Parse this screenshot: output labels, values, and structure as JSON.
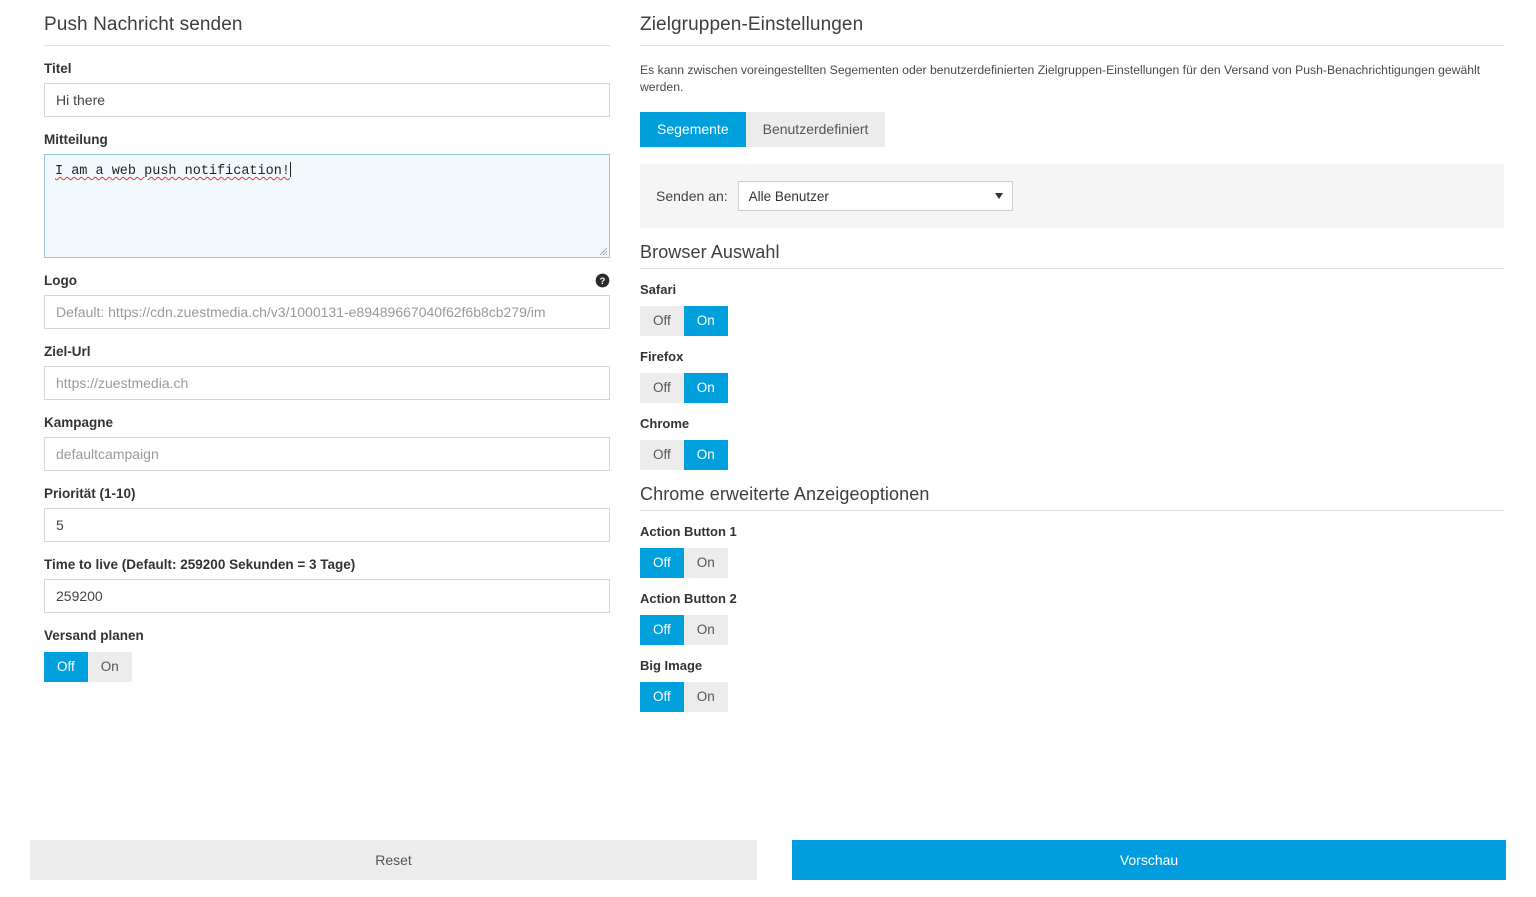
{
  "left": {
    "title": "Push Nachricht senden",
    "fields": {
      "titel": {
        "label": "Titel",
        "value": "Hi there"
      },
      "mitteilung": {
        "label": "Mitteilung",
        "value": "I am a web push notification!"
      },
      "logo": {
        "label": "Logo",
        "placeholder": "Default: https://cdn.zuestmedia.ch/v3/1000131-e89489667040f62f6b8cb279/im",
        "help_icon": "question-mark-circle-icon"
      },
      "ziel_url": {
        "label": "Ziel-Url",
        "placeholder": "https://zuestmedia.ch"
      },
      "kampagne": {
        "label": "Kampagne",
        "placeholder": "defaultcampaign"
      },
      "prioritaet": {
        "label": "Priorität (1-10)",
        "value": "5"
      },
      "ttl": {
        "label": "Time to live (Default: 259200 Sekunden = 3 Tage)",
        "value": "259200"
      },
      "versand_planen": {
        "label": "Versand planen",
        "off": "Off",
        "on": "On",
        "selected": "Off"
      }
    }
  },
  "right": {
    "title": "Zielgruppen-Einstellungen",
    "description": "Es kann zwischen voreingestellten Segementen oder benutzerdefinierten Zielgruppen-Einstellungen für den Versand von Push-Benachrichtigungen gewählt werden.",
    "segment_tabs": [
      {
        "label": "Segemente",
        "active": true
      },
      {
        "label": "Benutzerdefiniert",
        "active": false
      }
    ],
    "send_to": {
      "label": "Senden an:",
      "value": "Alle Benutzer",
      "arrow_icon": "chevron-down-icon"
    },
    "browser_section": {
      "title": "Browser Auswahl",
      "items": [
        {
          "label": "Safari",
          "off": "Off",
          "on": "On",
          "selected": "On"
        },
        {
          "label": "Firefox",
          "off": "Off",
          "on": "On",
          "selected": "On"
        },
        {
          "label": "Chrome",
          "off": "Off",
          "on": "On",
          "selected": "On"
        }
      ]
    },
    "chrome_section": {
      "title": "Chrome erweiterte Anzeigeoptionen",
      "items": [
        {
          "label": "Action Button 1",
          "off": "Off",
          "on": "On",
          "selected": "Off"
        },
        {
          "label": "Action Button 2",
          "off": "Off",
          "on": "On",
          "selected": "Off"
        },
        {
          "label": "Big Image",
          "off": "Off",
          "on": "On",
          "selected": "Off"
        }
      ]
    }
  },
  "footer": {
    "reset_label": "Reset",
    "preview_label": "Vorschau"
  },
  "colors": {
    "accent": "#00a0dd",
    "accent_button": "#009ede",
    "toggle_inactive": "#ececec",
    "textarea_bg": "#f2f9fd",
    "panel_bg": "#f5f5f5"
  }
}
